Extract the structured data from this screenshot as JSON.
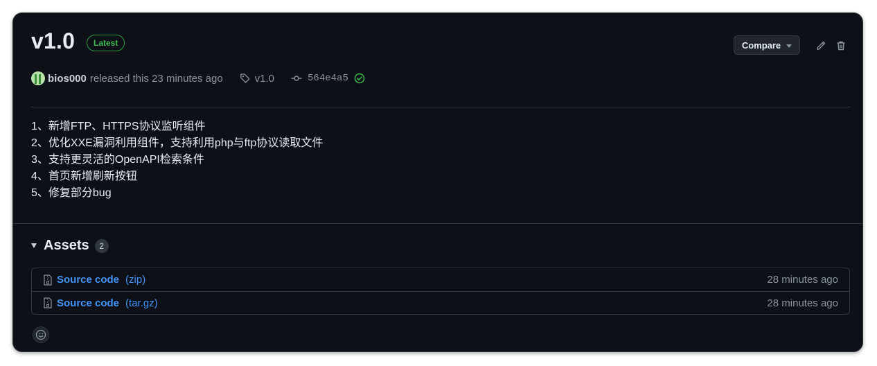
{
  "release": {
    "title": "v1.0",
    "badge": "Latest",
    "author": "bios000",
    "released_text": "released this 23 minutes ago",
    "tag": "v1.0",
    "commit": "564e4a5"
  },
  "toolbar": {
    "compare_label": "Compare"
  },
  "notes": [
    "1、新增FTP、HTTPS协议监听组件",
    "2、优化XXE漏洞利用组件，支持利用php与ftp协议读取文件",
    "3、支持更灵活的OpenAPI检索条件",
    "4、首页新增刷新按钮",
    "5、修复部分bug"
  ],
  "assets": {
    "heading": "Assets",
    "count": "2",
    "items": [
      {
        "name": "Source code",
        "ext": "(zip)",
        "time": "28 minutes ago"
      },
      {
        "name": "Source code",
        "ext": "(tar.gz)",
        "time": "28 minutes ago"
      }
    ]
  },
  "colors": {
    "background": "#0d1117",
    "accent_green": "#3fb950",
    "link_blue": "#4493f8",
    "border": "#30363d"
  },
  "icons": {
    "edit": "pencil-icon",
    "delete": "trash-icon",
    "tag": "tag-icon",
    "commit": "git-commit-icon",
    "verified": "check-circle-icon",
    "file": "file-zip-icon",
    "reaction": "smiley-icon"
  }
}
